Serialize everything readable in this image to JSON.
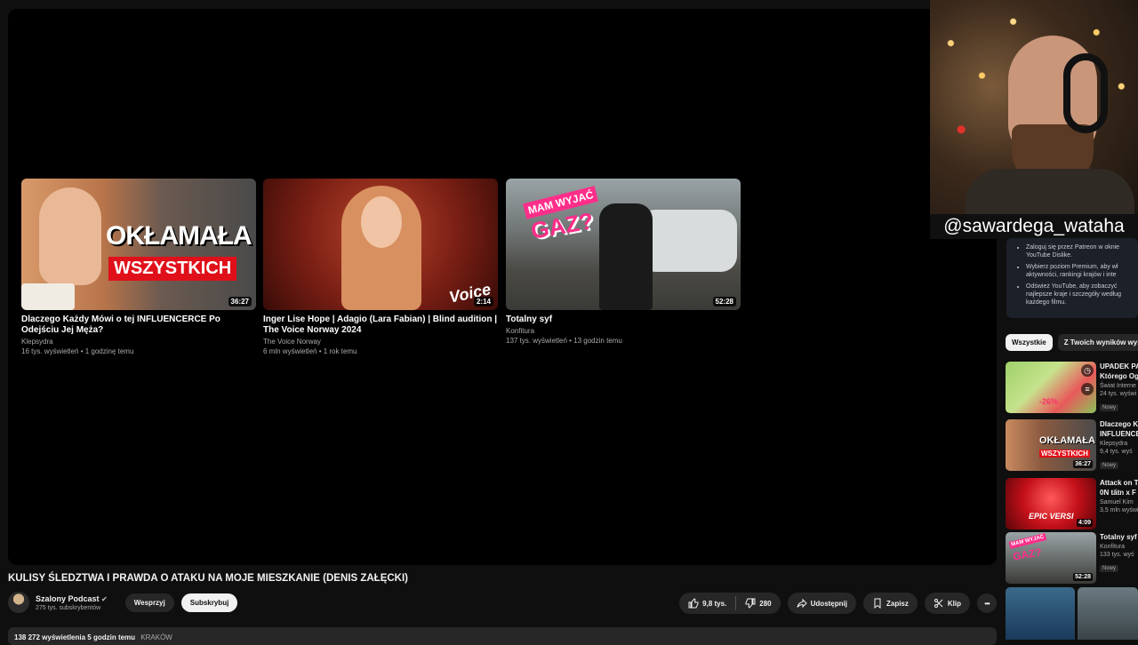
{
  "endscreen": {
    "cards": [
      {
        "title": "Dlaczego Każdy Mówi o tej INFLUENCERCE Po Odejściu Jej Męża?",
        "channel": "Klepsydra",
        "meta": "16 tys. wyświetleń • 1 godzinę temu",
        "duration": "36:27",
        "overlay": "OKŁAMAŁA",
        "overlay2": "WSZYSTKICH"
      },
      {
        "title": "Inger Lise Hope | Adagio (Lara Fabian) | Blind audition | The Voice Norway 2024",
        "channel": "The Voice Norway",
        "meta": "6 mln wyświetleń • 1 rok temu",
        "duration": "2:14",
        "overlay": "Voice"
      },
      {
        "title": "Totalny syf",
        "channel": "Konfitura",
        "meta": "137 tys. wyświetleń • 13 godzin temu",
        "duration": "52:28",
        "overlay": "MAM WYJAĆ",
        "overlay2": "GAZ?"
      }
    ]
  },
  "webcam": {
    "handle": "@sawardega_wataha"
  },
  "patreon_panel": {
    "items": [
      "Zaloguj się przez Patreon w oknie YouTube Dislike.",
      "Wybierz poziom Premium, aby wł aktywności, rankingi krajów i inte",
      "Odśwież YouTube, aby zobaczyć najlepsze kraje i szczegóły według każdego filmu."
    ]
  },
  "chips": [
    "Wszystkie",
    "Z Twoich wyników wys"
  ],
  "sidebar": [
    {
      "title": "UPADEK PA",
      "title2": "Którego Og",
      "channel": "Świat Interne",
      "views": "24 tys. wyświ",
      "badge": "Nowy",
      "duration": "",
      "overlay": "-26%"
    },
    {
      "title": "Dlaczego K",
      "title2": "INFLUENCE",
      "channel": "Klepsydra",
      "views": "9,4 tys. wyś",
      "badge": "Nowy",
      "duration": "36:27",
      "overlay": "OKŁAMAŁA",
      "overlay2": "WSZYSTKICH"
    },
    {
      "title": "Attack on T",
      "title2": "0N tấtn x F",
      "channel": "Samuel Kim",
      "views": "3,5 mln wyświ",
      "badge": "",
      "duration": "4:09",
      "overlay": "EPIC VERSI"
    },
    {
      "title": "Totalny syf",
      "title2": "",
      "channel": "Konfitura",
      "views": "133 tys. wyś",
      "badge": "Nowy",
      "duration": "52:28",
      "overlay": "MAM WYJAĆ",
      "overlay2": "GAZ?"
    }
  ],
  "video": {
    "title": "KULISY ŚLEDZTWA I PRAWDA O ATAKU NA MOJE MIESZKANIE (DENIS ZAŁĘCKI)",
    "channel": "Szalony Podcast",
    "subscribers": "275 tys. subskrybentów",
    "support_label": "Wesprzyj",
    "subscribe_label": "Subskrybuj",
    "likes": "9,8 tys.",
    "dislikes": "280",
    "share_label": "Udostępnij",
    "save_label": "Zapisz",
    "clip_label": "Klip",
    "more_label": "•••",
    "description_line": "138 272 wyświetlenia  5 godzin temu",
    "location": "KRAKÓW"
  },
  "colors": {
    "background": "#0f0f0f",
    "surface": "#272727",
    "text": "#f1f1f1",
    "secondary_text": "#aaaaaa",
    "overlay_red": "#e0101a",
    "overlay_pink": "#ff2e8a"
  }
}
